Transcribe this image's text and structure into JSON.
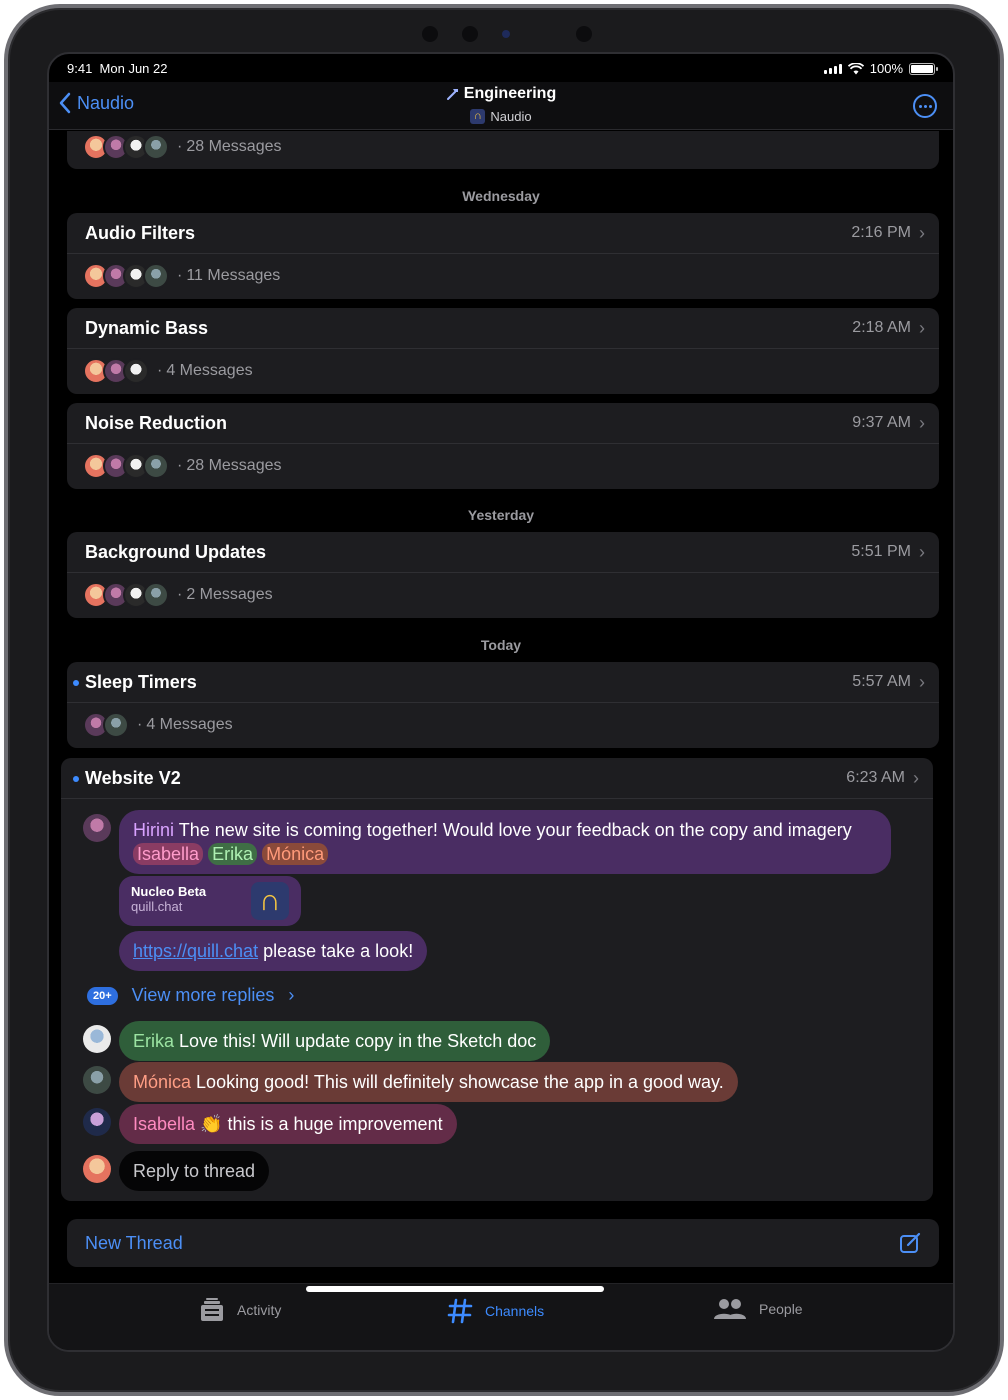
{
  "status": {
    "time": "9:41",
    "date": "Mon Jun 22",
    "battery": "100%"
  },
  "nav": {
    "back": "Naudio",
    "title": "Engineering",
    "subtitle": "Naudio"
  },
  "sections": {
    "wednesday": "Wednesday",
    "yesterday": "Yesterday",
    "today": "Today"
  },
  "threads": [
    {
      "title": "",
      "time": "",
      "messages": "28 Messages"
    },
    {
      "title": "Audio Filters",
      "time": "2:16 PM",
      "messages": "11 Messages"
    },
    {
      "title": "Dynamic Bass",
      "time": "2:18 AM",
      "messages": "4 Messages"
    },
    {
      "title": "Noise Reduction",
      "time": "9:37 AM",
      "messages": "28 Messages"
    },
    {
      "title": "Background Updates",
      "time": "5:51 PM",
      "messages": "2 Messages"
    },
    {
      "title": "Sleep Timers",
      "time": "5:57 AM",
      "messages": "4 Messages"
    }
  ],
  "expanded": {
    "title": "Website V2",
    "time": "6:23 AM",
    "first_message": {
      "author": "Hirini",
      "text": "The new site is coming together! Would love your feedback on the copy and imagery",
      "mentions": [
        "Isabella",
        "Erika",
        "Mónica"
      ]
    },
    "link_preview": {
      "title": "Nucleo Beta",
      "site": "quill.chat"
    },
    "link_message": {
      "url": "https://quill.chat",
      "text": "please take a look!"
    },
    "more_replies": {
      "badge": "20+",
      "label": "View more replies"
    },
    "replies": [
      {
        "author": "Erika",
        "text": "Love this! Will update copy in the Sketch doc"
      },
      {
        "author": "Mónica",
        "text": "Looking good! This will definitely showcase the app in a good way."
      },
      {
        "author": "Isabella",
        "text": "👏 this is a huge improvement"
      }
    ],
    "reply_placeholder": "Reply to thread"
  },
  "new_thread": "New Thread",
  "tabs": {
    "activity": "Activity",
    "channels": "Channels",
    "people": "People",
    "active": "channels"
  },
  "colors": {
    "accent": "#3d8bff",
    "card": "#1d1d20",
    "background": "#000000"
  }
}
